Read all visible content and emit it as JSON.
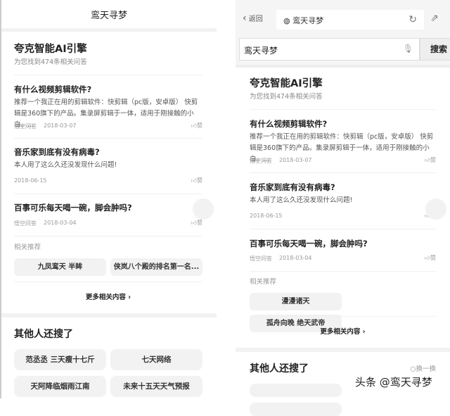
{
  "left": {
    "title": "鸾天寻梦"
  },
  "right": {
    "back": "返回",
    "url": "鸾天寻梦",
    "search_value": "鸾天寻梦",
    "search_btn": "搜索"
  },
  "engine": "夸克智能AI引擎",
  "found": "为您找到474条相关问答",
  "results": [
    {
      "title": "有什么视频剪辑软件?",
      "snippet": "推荐一个我正在用的剪辑软件：快剪辑（pc版，安卓版） 快剪辑是360旗下的产品。集录屏剪辑于一体，适用于刚接触的小白。...",
      "source": "悟空问答",
      "date": "2018-03-07",
      "like": "赞"
    },
    {
      "title": "音乐家到底有没有病毒?",
      "snippet": "本人用了这么久还没发现什么问题!",
      "source": "",
      "date": "2018-06-15",
      "like": "赞"
    },
    {
      "title": "百事可乐每天喝一碗，脚会肿吗?",
      "snippet": "",
      "source": "悟空问答",
      "date": "2018-03-04",
      "like": "赞"
    }
  ],
  "related_label": "相关推荐",
  "left_related": [
    "九凤鸾天 半眸",
    "侠岚八个殿的排名第一名..."
  ],
  "right_related": [
    "漫漫诸天",
    "孤舟向晚 绝天武帝"
  ],
  "more": "更多相关内容 ›",
  "others": "其他人还搜了",
  "swap": "○换一换",
  "others_items": [
    "范丞丞 三天瘦十七斤",
    "七天网络",
    "天阿降临烟雨江南",
    "未来十五天天气预报"
  ],
  "watermark": "头条 @鸾天寻梦"
}
